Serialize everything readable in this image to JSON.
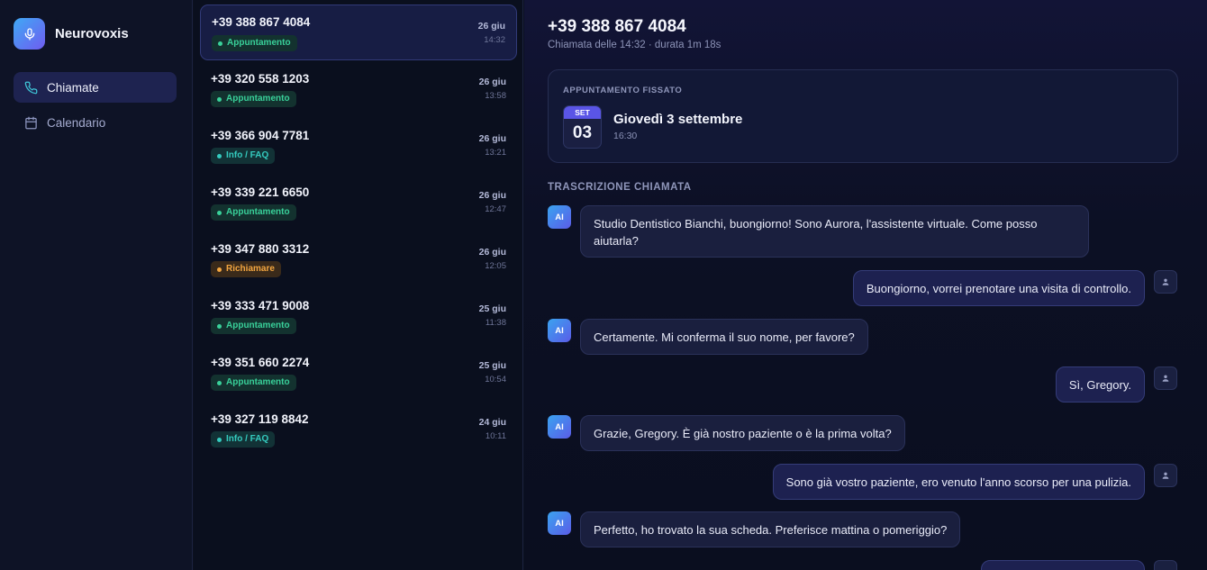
{
  "app": {
    "name": "Neurovoxis"
  },
  "sidebar": {
    "items": [
      {
        "label": "Chiamate",
        "icon": "phone-icon",
        "active": true
      },
      {
        "label": "Calendario",
        "icon": "calendar-icon",
        "active": false
      }
    ]
  },
  "calls": [
    {
      "number": "+39 388 867 4084",
      "tag": "Appuntamento",
      "tag_color": "green",
      "date": "26 giu",
      "time": "14:32",
      "active": true
    },
    {
      "number": "+39 320 558 1203",
      "tag": "Appuntamento",
      "tag_color": "green",
      "date": "26 giu",
      "time": "13:58"
    },
    {
      "number": "+39 366 904 7781",
      "tag": "Info / FAQ",
      "tag_color": "teal",
      "date": "26 giu",
      "time": "13:21"
    },
    {
      "number": "+39 339 221 6650",
      "tag": "Appuntamento",
      "tag_color": "green",
      "date": "26 giu",
      "time": "12:47"
    },
    {
      "number": "+39 347 880 3312",
      "tag": "Richiamare",
      "tag_color": "orange",
      "date": "26 giu",
      "time": "12:05"
    },
    {
      "number": "+39 333 471 9008",
      "tag": "Appuntamento",
      "tag_color": "green",
      "date": "25 giu",
      "time": "11:38"
    },
    {
      "number": "+39 351 660 2274",
      "tag": "Appuntamento",
      "tag_color": "green",
      "date": "25 giu",
      "time": "10:54"
    },
    {
      "number": "+39 327 119 8842",
      "tag": "Info / FAQ",
      "tag_color": "teal",
      "date": "24 giu",
      "time": "10:11"
    }
  ],
  "detail": {
    "number": "+39 388 867 4084",
    "subtitle": "Chiamata delle 14:32 · durata 1m 18s",
    "appointment": {
      "label": "APPUNTAMENTO FISSATO",
      "month": "SET",
      "day": "03",
      "date": "Giovedì 3 settembre",
      "time": "16:30"
    },
    "transcript_label": "TRASCRIZIONE CHIAMATA",
    "ai_avatar": "AI",
    "messages": [
      {
        "from": "ai",
        "text": "Studio Dentistico Bianchi, buongiorno! Sono Aurora, l'assistente virtuale. Come posso aiutarla?"
      },
      {
        "from": "user",
        "text": "Buongiorno, vorrei prenotare una visita di controllo."
      },
      {
        "from": "ai",
        "text": "Certamente. Mi conferma il suo nome, per favore?"
      },
      {
        "from": "user",
        "text": "Sì, Gregory."
      },
      {
        "from": "ai",
        "text": "Grazie, Gregory. È già nostro paziente o è la prima volta?"
      },
      {
        "from": "user",
        "text": "Sono già vostro paziente, ero venuto l'anno scorso per una pulizia."
      },
      {
        "from": "ai",
        "text": "Perfetto, ho trovato la sua scheda. Preferisce mattina o pomeriggio?"
      },
      {
        "from": "user",
        "text": ""
      }
    ]
  },
  "colors": {
    "accent": "#5a55e6",
    "badge_green": "#39d19a",
    "badge_teal": "#34cbbf",
    "badge_orange": "#f3a640"
  }
}
